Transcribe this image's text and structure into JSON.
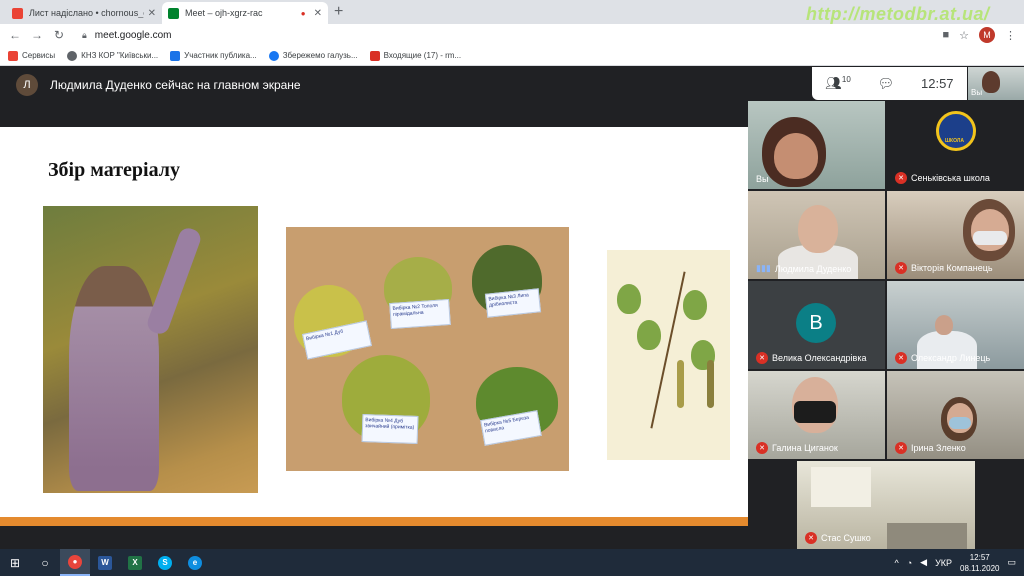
{
  "browser": {
    "tabs": [
      {
        "title": "Лист надіслано • chornous_o_v@...",
        "favicon_color": "#ea4335"
      },
      {
        "title": "Meet – ojh-xgrz-rac",
        "favicon_color": "#00832d"
      }
    ],
    "watermark": "http://metodbr.at.ua/",
    "url": "meet.google.com",
    "profile_initial": "M",
    "bookmarks": [
      {
        "label": "Сервисы",
        "icon": "apps-icon",
        "color": "#ea4335"
      },
      {
        "label": "КНЗ КОР \"Київськи...",
        "icon": "globe-icon",
        "color": "#5f6368"
      },
      {
        "label": "Участник публика...",
        "icon": "page-icon",
        "color": "#1a73e8"
      },
      {
        "label": "Збережемо галузь...",
        "icon": "facebook-icon",
        "color": "#1877f2"
      },
      {
        "label": "Входящие (17) - rm...",
        "icon": "mail-icon",
        "color": "#d93025"
      }
    ]
  },
  "meet": {
    "presenter_initial": "Л",
    "presenter_text": "Людмила Дуденко сейчас на главном экране",
    "participants_count": "10",
    "time": "12:57",
    "self_label": "Вы",
    "slide": {
      "title": "Збір матеріалу",
      "notes": [
        "Вибірка №1 Дуб",
        "Вибірка №2 Тополя пірамідальна",
        "Вибірка №3 Липа дрібнолиста",
        "Вибірка №4 Дуб звичайний (примітка)",
        "Вибірка №5 Береза повисла"
      ]
    },
    "tiles": [
      {
        "name": "Вы",
        "muted": false
      },
      {
        "name": "Сеньківська школа",
        "muted": true
      },
      {
        "name": "Людмила Дуденко",
        "muted": false,
        "speaking": true
      },
      {
        "name": "Вікторія Компанець",
        "muted": true
      },
      {
        "name": "Велика Олександрівка",
        "muted": true,
        "avatar_letter": "В"
      },
      {
        "name": "Олександр Линець",
        "muted": true
      },
      {
        "name": "Галина Циганок",
        "muted": true
      },
      {
        "name": "Ірина Зленко",
        "muted": true
      },
      {
        "name": "Стас Сушко",
        "muted": true
      }
    ],
    "school_logo_text": "ШКОЛА"
  },
  "taskbar": {
    "apps": [
      "windows-start-icon",
      "search-icon",
      "chrome-icon",
      "word-icon",
      "excel-icon",
      "skype-icon",
      "edge-icon"
    ],
    "language": "УКР",
    "clock_time": "12:57",
    "clock_date": "08.11.2020"
  },
  "colors": {
    "accent_strip": "#e48a2e",
    "mute_red": "#d93025",
    "meet_bg": "#202124"
  }
}
